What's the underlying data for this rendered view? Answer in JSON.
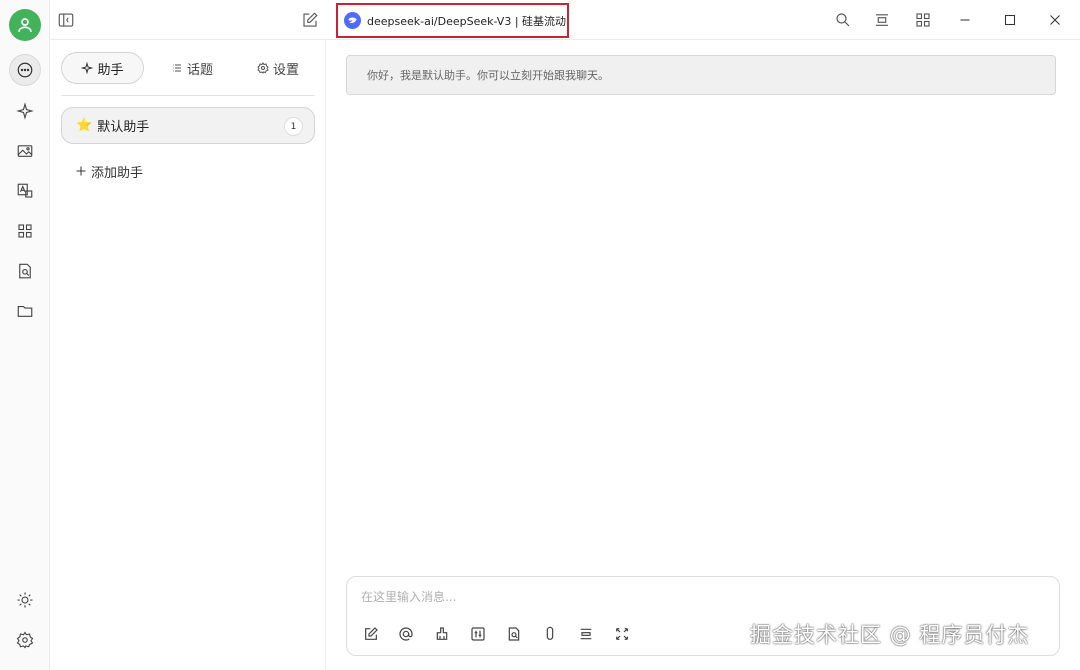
{
  "model_chip": {
    "label": "deepseek-ai/DeepSeek-V3 | 硅基流动"
  },
  "tabs": [
    {
      "label": "助手",
      "icon": "sparkle-icon",
      "active": true
    },
    {
      "label": "话题",
      "icon": "list-icon",
      "active": false
    },
    {
      "label": "设置",
      "icon": "gear-icon",
      "active": false
    }
  ],
  "assistants": [
    {
      "emoji": "⭐",
      "name": "默认助手",
      "count": "1"
    }
  ],
  "add_assistant_label": "添加助手",
  "welcome_message": "你好，我是默认助手。你可以立刻开始跟我聊天。",
  "composer": {
    "placeholder": "在这里输入消息..."
  },
  "watermark": "掘金技术社区 @ 程序员付杰",
  "colors": {
    "avatar": "#43b35b",
    "highlight_border": "#cc2233",
    "model_logo": "#4d6bfe"
  },
  "rail_icons": [
    "chat-icon",
    "sparkle-icon",
    "image-icon",
    "translate-icon",
    "apps-icon",
    "file-search-icon",
    "folder-icon",
    "sun-icon",
    "settings-icon"
  ]
}
